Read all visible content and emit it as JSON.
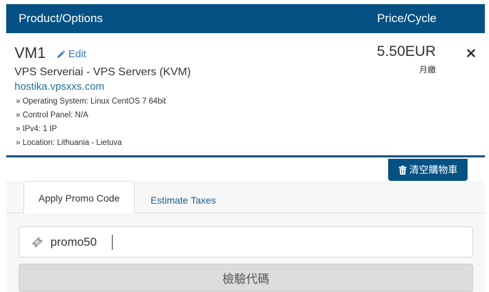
{
  "header": {
    "product_label": "Product/Options",
    "price_label": "Price/Cycle"
  },
  "item": {
    "name": "VM1",
    "edit_label": "Edit",
    "group": "VPS Serveriai - VPS Servers (KVM)",
    "domain": "hostika.vpsxxs.com",
    "details": [
      "» Operating System: Linux CentOS 7 64bit",
      "» Control Panel: N/A",
      "» IPv4: 1 IP",
      "» Location: Lithuania - Lietuva"
    ],
    "price": "5.50EUR",
    "cycle": "月繳",
    "remove_icon": "close-icon"
  },
  "empty_cart": {
    "label": "清空購物車",
    "icon": "trash-icon"
  },
  "tabs": {
    "active": "Apply Promo Code",
    "inactive": "Estimate Taxes"
  },
  "promo": {
    "value": "promo50",
    "icon": "ticket-icon",
    "validate_label": "檢驗代碼"
  },
  "colors": {
    "primary": "#055183",
    "link": "#3a76a8",
    "panel_bg": "#f7f7f7",
    "button_grey": "#dcdcdc"
  }
}
